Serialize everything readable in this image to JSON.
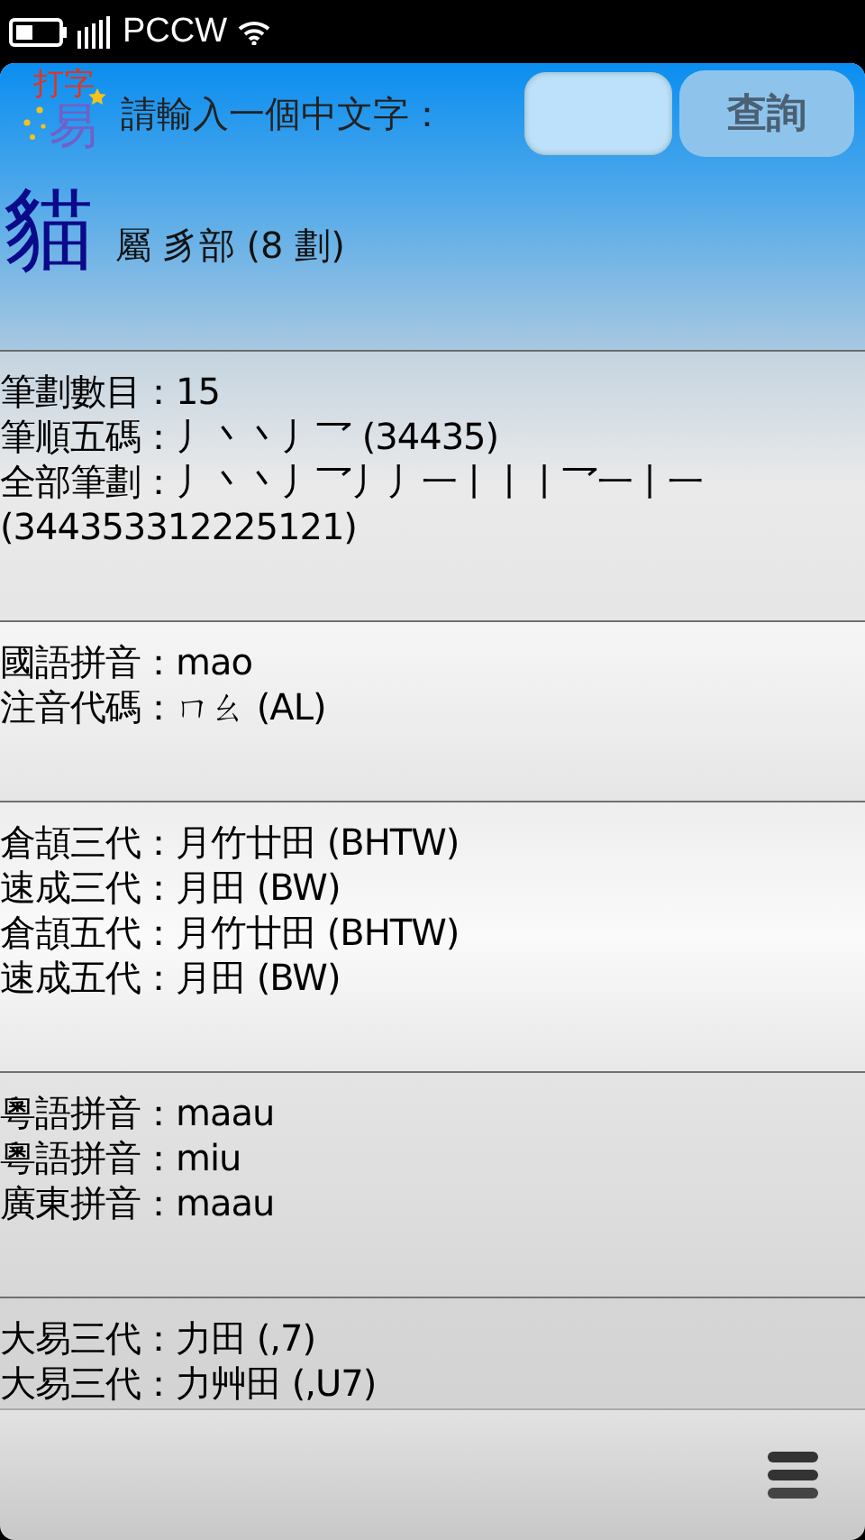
{
  "status_bar": {
    "carrier": "PCCW"
  },
  "header": {
    "logo": {
      "top": "打字",
      "bottom": "易"
    },
    "prompt": "請輸入一個中文字：",
    "button": "查詢"
  },
  "result": {
    "character": "貓",
    "radical": "屬 豸部 (8 劃)"
  },
  "sections": [
    {
      "lines": [
        "筆劃數目：15",
        "筆順五碼：丿丶丶丿乛 (34435)",
        "全部筆劃：丿丶丶丿乛丿丿一丨丨丨乛一丨一",
        "(344353312225121)"
      ]
    },
    {
      "lines": [
        "國語拼音：mao",
        "注音代碼：ㄇㄠ (AL)"
      ]
    },
    {
      "lines": [
        "倉頡三代：月竹廿田 (BHTW)",
        "速成三代：月田 (BW)",
        "倉頡五代：月竹廿田 (BHTW)",
        "速成五代：月田 (BW)"
      ]
    },
    {
      "lines": [
        "粵語拼音：maau",
        "粵語拼音：miu",
        "廣東拼音：maau"
      ]
    },
    {
      "lines": [
        "大易三代：力田 (,7)",
        "大易三代：力艸田 (,U7)"
      ]
    }
  ]
}
